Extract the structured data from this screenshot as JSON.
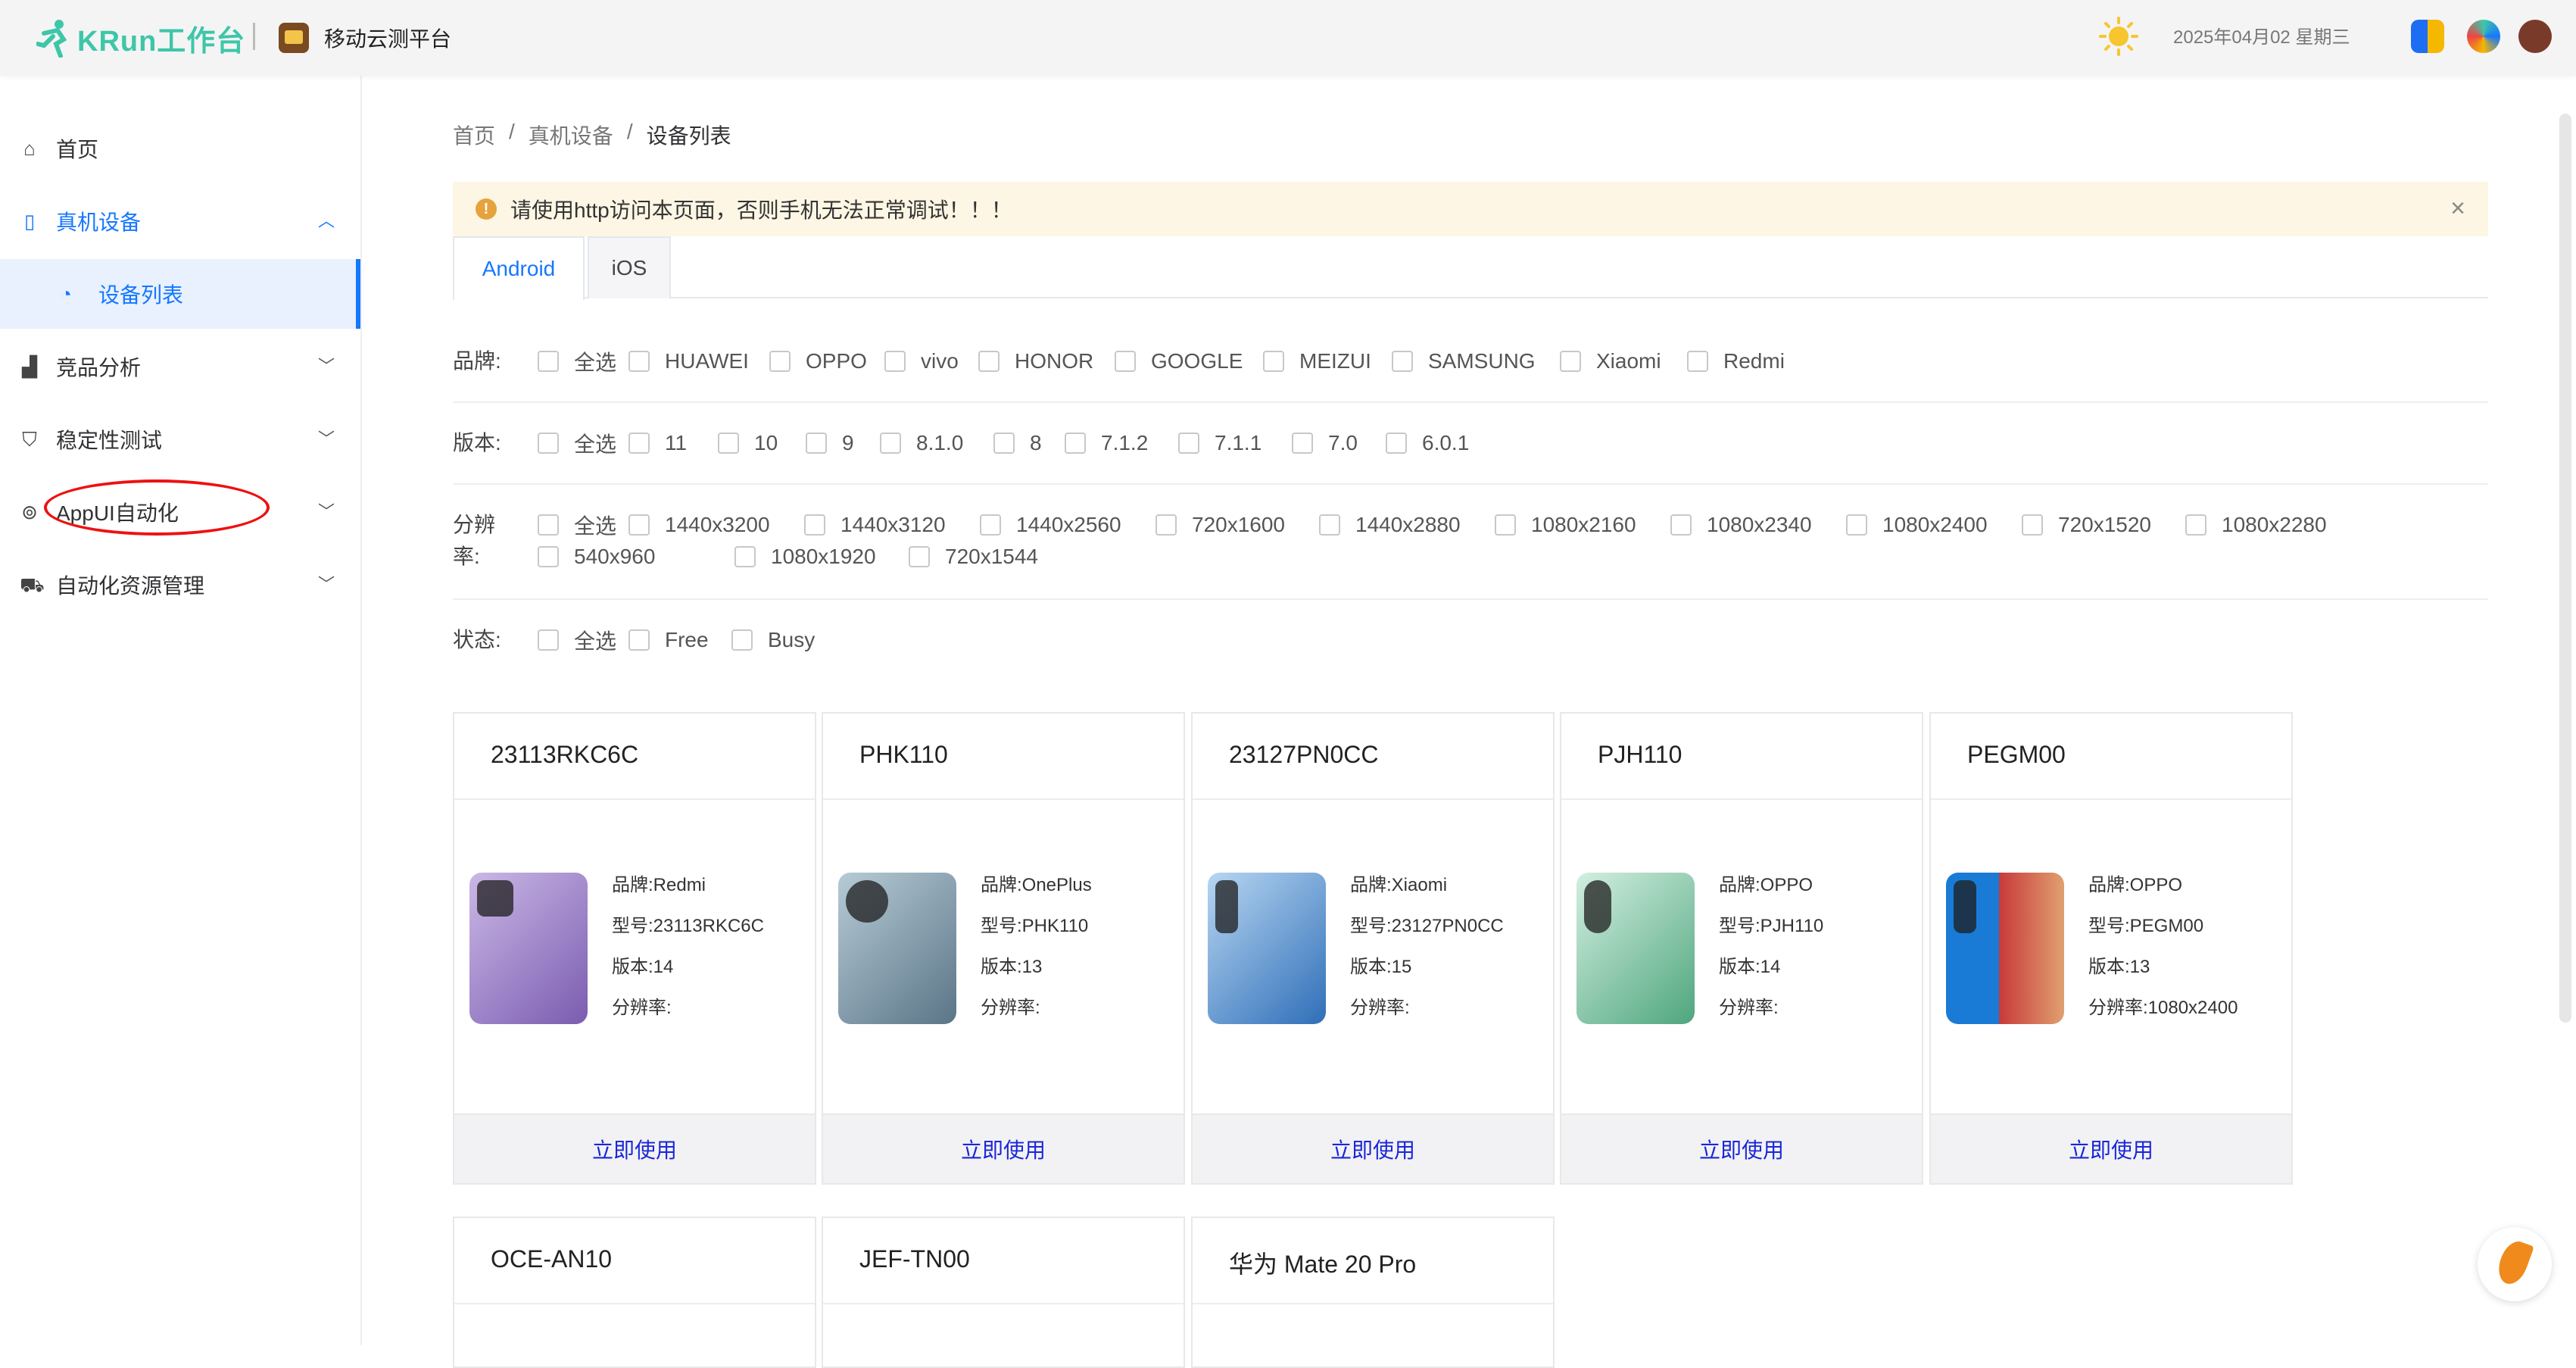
{
  "header": {
    "logo_text": "KRun工作台",
    "platform_name": "移动云测平台",
    "datetime": "2025年04月02 星期三"
  },
  "sidebar": {
    "items": [
      {
        "label": "首页",
        "icon": "home-icon"
      },
      {
        "label": "真机设备",
        "icon": "phone-icon",
        "expanded": true,
        "active": true
      },
      {
        "label": "设备列表",
        "icon": "apple-icon",
        "sub": true,
        "selected": true
      },
      {
        "label": "竞品分析",
        "icon": "chart-icon"
      },
      {
        "label": "稳定性测试",
        "icon": "shield-icon"
      },
      {
        "label": "AppUI自动化",
        "icon": "robot-icon"
      },
      {
        "label": "自动化资源管理",
        "icon": "cart-icon"
      }
    ]
  },
  "breadcrumb": [
    "首页",
    "真机设备",
    "设备列表"
  ],
  "breadcrumb_sep": "/",
  "alert": {
    "text": "请使用http访问本页面，否则手机无法正常调试！！！",
    "close": "×",
    "icon": "!"
  },
  "tabs": [
    "Android",
    "iOS"
  ],
  "filters": {
    "brand": {
      "label": "品牌:",
      "options": [
        "全选",
        "HUAWEI",
        "OPPO",
        "vivo",
        "HONOR",
        "GOOGLE",
        "MEIZUI",
        "SAMSUNG",
        "Xiaomi",
        "Redmi"
      ]
    },
    "version": {
      "label": "版本:",
      "options": [
        "全选",
        "11",
        "10",
        "9",
        "8.1.0",
        "8",
        "7.1.2",
        "7.1.1",
        "7.0",
        "6.0.1"
      ]
    },
    "resolution": {
      "label_line1": "分辨",
      "label_line2": "率:",
      "options": [
        "全选",
        "1440x3200",
        "1440x3120",
        "1440x2560",
        "720x1600",
        "1440x2880",
        "1080x2160",
        "1080x2340",
        "1080x2400",
        "720x1520",
        "1080x2280",
        "540x960",
        "1080x1920",
        "720x1544"
      ]
    },
    "status": {
      "label": "状态:",
      "options": [
        "全选",
        "Free",
        "Busy"
      ]
    }
  },
  "devices": [
    {
      "title": "23113RKC6C",
      "brand": "品牌:Redmi",
      "model": "型号:23113RKC6C",
      "version": "版本:14",
      "resolution": "分辨率:",
      "action": "立即使用"
    },
    {
      "title": "PHK110",
      "brand": "品牌:OnePlus",
      "model": "型号:PHK110",
      "version": "版本:13",
      "resolution": "分辨率:",
      "action": "立即使用"
    },
    {
      "title": "23127PN0CC",
      "brand": "品牌:Xiaomi",
      "model": "型号:23127PN0CC",
      "version": "版本:15",
      "resolution": "分辨率:",
      "action": "立即使用"
    },
    {
      "title": "PJH110",
      "brand": "品牌:OPPO",
      "model": "型号:PJH110",
      "version": "版本:14",
      "resolution": "分辨率:",
      "action": "立即使用"
    },
    {
      "title": "PEGM00",
      "brand": "品牌:OPPO",
      "model": "型号:PEGM00",
      "version": "版本:13",
      "resolution": "分辨率:1080x2400",
      "action": "立即使用"
    },
    {
      "title": "OCE-AN10"
    },
    {
      "title": "JEF-TN00"
    },
    {
      "title": "华为 Mate 20 Pro"
    }
  ],
  "colors": {
    "accent": "#1677ff",
    "alert_bg": "#fdf6e4",
    "warning": "#e6a23c",
    "annotation": "#e11111",
    "action_link": "#1a26d8"
  }
}
